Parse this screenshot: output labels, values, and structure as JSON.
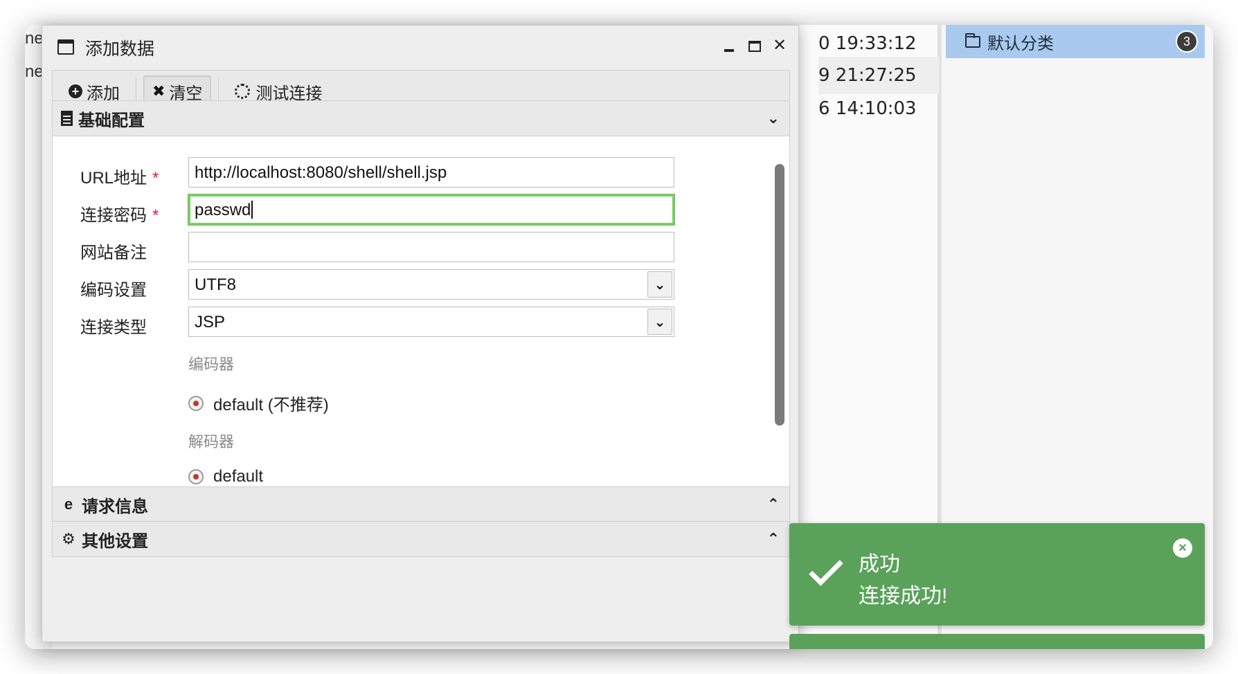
{
  "background": {
    "left_fragments": [
      "ne",
      "ne"
    ],
    "times": [
      "0 19:33:12",
      "9 21:27:25",
      "6 14:10:03"
    ],
    "category": {
      "label": "默认分类",
      "count": "3",
      "icon": "folder-icon"
    }
  },
  "dialog": {
    "title": "添加数据",
    "toolbar": {
      "add_label": "添加",
      "clear_label": "清空",
      "test_label": "测试连接"
    },
    "sections": {
      "basic": "基础配置",
      "request": "请求信息",
      "other": "其他设置"
    },
    "form": {
      "url_label": "URL地址",
      "url_value": "http://localhost:8080/shell/shell.jsp",
      "password_label": "连接密码",
      "password_value": "passwd",
      "note_label": "网站备注",
      "note_value": "",
      "encoding_label": "编码设置",
      "encoding_value": "UTF8",
      "type_label": "连接类型",
      "type_value": "JSP",
      "required_mark": "*",
      "encoder_heading": "编码器",
      "encoder_option": "default (不推荐)",
      "decoder_heading": "解码器",
      "decoder_option": "default"
    }
  },
  "toast": {
    "title": "成功",
    "message": "连接成功!",
    "color": "#5aa25a"
  }
}
